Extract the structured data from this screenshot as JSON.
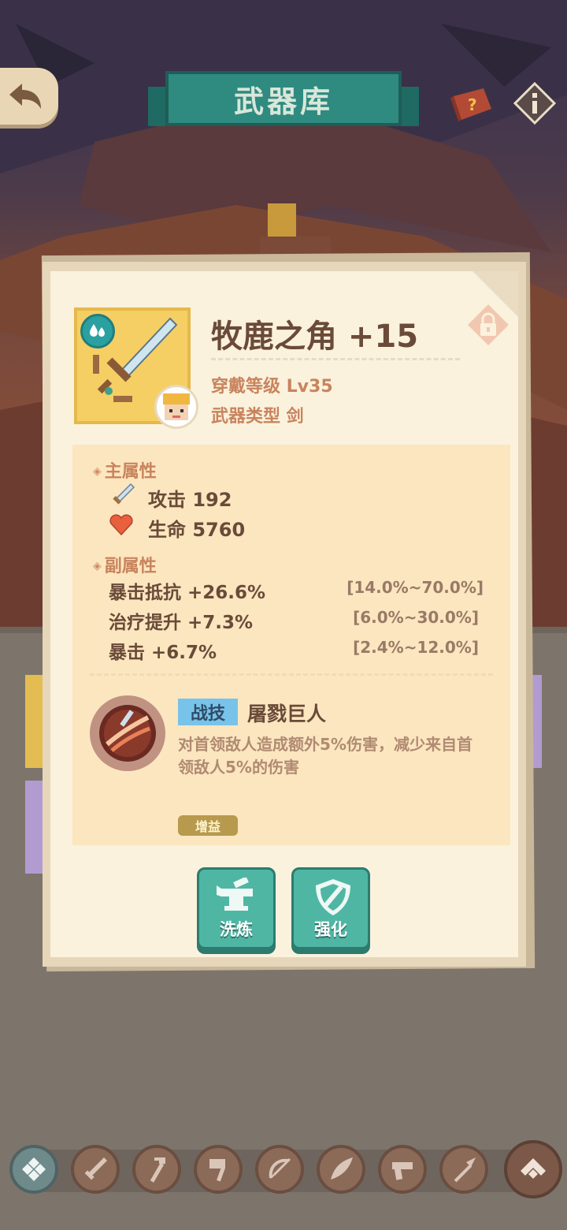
{
  "header": {
    "title": "武器库",
    "back_icon": "back-arrow-icon",
    "book_icon": "help-book-icon",
    "info_icon": "info-icon"
  },
  "weapon": {
    "name": "牧鹿之角 +15",
    "element_icon": "water-drop-icon",
    "wear_level": "穿戴等级 Lv35",
    "weapon_type": "武器类型 剑",
    "locked_icon": "lock-icon"
  },
  "main_attributes": {
    "title": "主属性",
    "items": [
      {
        "icon": "sword-icon",
        "label": "攻击 192"
      },
      {
        "icon": "heart-icon",
        "label": "生命 5760"
      }
    ]
  },
  "sub_attributes": {
    "title": "副属性",
    "items": [
      {
        "label": "暴击抵抗 +26.6%",
        "range": "[14.0%~70.0%]"
      },
      {
        "label": "治疗提升 +7.3%",
        "range": "[6.0%~30.0%]"
      },
      {
        "label": "暴击 +6.7%",
        "range": "[2.4%~12.0%]"
      }
    ]
  },
  "skill": {
    "tag": "战技",
    "name": "屠戮巨人",
    "description": "对首领敌人造成额外5%伤害，减少来自首领敌人5%的伤害",
    "buff_tag": "增益"
  },
  "actions": {
    "reforge": "洗炼",
    "enhance": "强化"
  },
  "bottom_nav": [
    "all-icon",
    "sword-icon",
    "staff-icon",
    "hammer-icon",
    "bow-icon",
    "wing-icon",
    "gun-icon",
    "spear-icon",
    "collapse-up-icon"
  ],
  "colors": {
    "accent_teal": "#4fb6a4",
    "title_text": "#6a4a38",
    "label_orange": "#c8845e",
    "skill_tag_blue": "#78c3ea"
  }
}
